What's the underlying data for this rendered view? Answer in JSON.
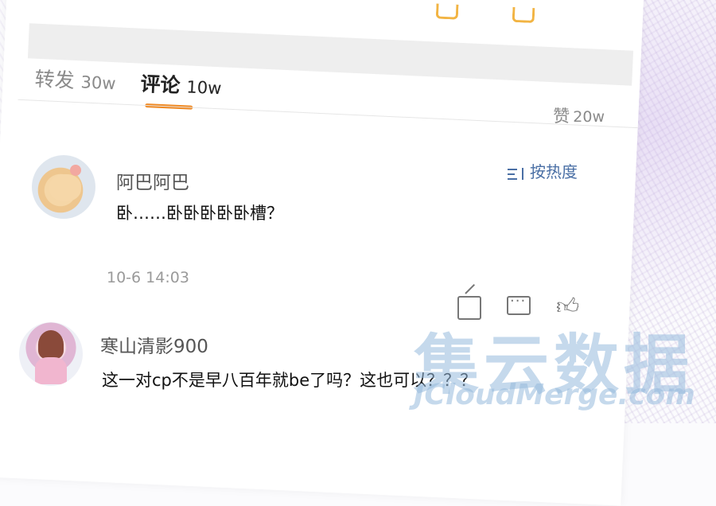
{
  "tabs": {
    "repost_label": "转发",
    "repost_count": "30w",
    "comment_label": "评论",
    "comment_count": "10w",
    "likes_label": "赞",
    "likes_count": "20w"
  },
  "sort": {
    "label": "按热度",
    "icon": "sort-icon"
  },
  "comments": [
    {
      "author": "阿巴阿巴",
      "text": "卧……卧卧卧卧卧槽？",
      "time": "10-6 14:03",
      "actions": [
        "share-icon",
        "reply-icon",
        "like-icon"
      ]
    },
    {
      "author": "寒山清影900",
      "text": "这一对cp不是早八百年就be了吗？这也可以？？？"
    }
  ],
  "watermark": {
    "text": "集云数据",
    "sub": "JCloudMerge.com"
  },
  "colors": {
    "accent": "#f08a24",
    "link": "#4a6fa5"
  }
}
